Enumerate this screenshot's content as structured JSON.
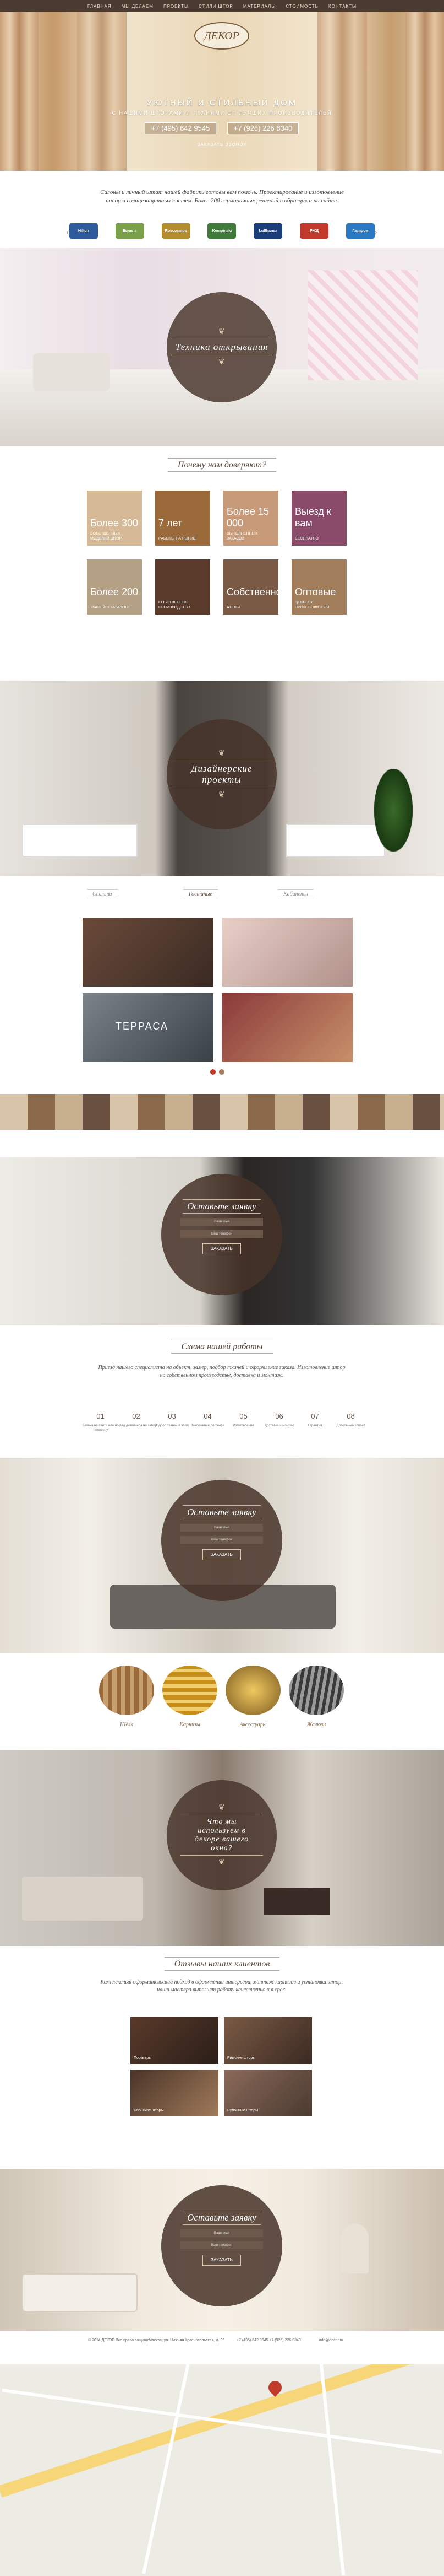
{
  "nav": [
    "ГЛАВНАЯ",
    "МЫ ДЕЛАЕМ",
    "ПРОЕКТЫ",
    "СТИЛИ ШТОР",
    "МАТЕРИАЛЫ",
    "СТОИМОСТЬ",
    "КОНТАКТЫ"
  ],
  "hero": {
    "logo": "ДЕКОР",
    "slogan": "УЮТНЫЙ И СТИЛЬНЫЙ ДОМ",
    "slogan2": "С НАШИМИ ШТОРАМИ И ТКАНЯМИ ОТ ЛУЧШИХ ПРОИЗВОДИТЕЛЕЙ",
    "phone1": "+7 (495) 642 9545",
    "phone2": "+7 (926) 226 8340",
    "link": "ЗАКАЗАТЬ ЗВОНОК"
  },
  "intro": {
    "text": "Салоны и личный штат нашей фабрики готовы вам помочь. Проектирование и изготовление штор и солнцезащитных систем. Более 200 гармоничных решений в образцах и на сайте.",
    "partners": [
      "Hilton",
      "Eurasia",
      "Roscosmos",
      "Kempinski",
      "Lufthansa",
      "РЖД",
      "Газпром"
    ]
  },
  "sec1": {
    "title": "Техника открывания"
  },
  "why": {
    "title": "Почему нам доверяют?",
    "tiles": [
      {
        "n": "Более 300",
        "d": "собственных моделей штор"
      },
      {
        "n": "7 лет",
        "d": "работы на рынке"
      },
      {
        "n": "Более 15 000",
        "d": "выполненных заказов"
      },
      {
        "n": "Выезд к вам",
        "d": "бесплатно"
      },
      {
        "n": "Более 200",
        "d": "тканей в каталоге"
      },
      {
        "n": "",
        "d": "собственное производство"
      },
      {
        "n": "Собственное",
        "d": "ателье"
      },
      {
        "n": "Оптовые",
        "d": "цены от производителя"
      }
    ]
  },
  "sec2": {
    "title": "Дизайнерские проекты"
  },
  "projects": {
    "tabs": [
      "Спальни",
      "Гостиные",
      "Кабинеты"
    ],
    "items": [
      {
        "label": ""
      },
      {
        "label": ""
      },
      {
        "label": "ТЕРРАСА"
      },
      {
        "label": ""
      }
    ]
  },
  "form1": {
    "title": "Оставьте заявку",
    "name": "Ваше имя",
    "phone": "Ваш телефон",
    "btn": "ЗАКАЗАТЬ"
  },
  "scheme": {
    "title": "Схема нашей работы",
    "text": "Приезд нашего специалиста на объект, замер, подбор тканей и оформление заказа. Изготовление штор на собственном производстве, доставка и монтаж.",
    "steps": [
      {
        "n": "01",
        "d": "Заявка на сайте или по телефону"
      },
      {
        "n": "02",
        "d": "Выезд дизайнера на замер"
      },
      {
        "n": "03",
        "d": "Подбор тканей и эскиз"
      },
      {
        "n": "04",
        "d": "Заключение договора"
      },
      {
        "n": "05",
        "d": "Изготовление"
      },
      {
        "n": "06",
        "d": "Доставка и монтаж"
      },
      {
        "n": "07",
        "d": "Гарантия"
      },
      {
        "n": "08",
        "d": "Довольный клиент"
      }
    ]
  },
  "form2": {
    "title": "Оставьте заявку",
    "name": "Ваше имя",
    "phone": "Ваш телефон",
    "btn": "ЗАКАЗАТЬ"
  },
  "materials": {
    "items": [
      "Шёлк",
      "Карнизы",
      "Аксессуары",
      "Жалюзи"
    ]
  },
  "sec3": {
    "title": "Что мы используем в декоре вашего окна?"
  },
  "portfolio": {
    "title": "Отзывы наших клиентов",
    "text": "Комплексный оформительский подход в оформлении интерьера, монтаж карнизов и установка штор: наши мастера выполнят работу качественно и в срок.",
    "items": [
      {
        "label": "Портьеры"
      },
      {
        "label": "Римские шторы"
      },
      {
        "label": "Японские шторы"
      },
      {
        "label": "Рулонные шторы"
      }
    ]
  },
  "form3": {
    "title": "Оставьте заявку",
    "name": "Ваше имя",
    "phone": "Ваш телефон",
    "btn": "ЗАКАЗАТЬ"
  },
  "footer": {
    "col1": "© 2014 ДЕКОР\nВсе права защищены",
    "col2": "Москва, ул. Нижняя Красносельская, д. 35",
    "col3": "+7 (495) 642 9545\n+7 (926) 226 8340",
    "col4": "info@decor.ru"
  },
  "colors": {
    "brown": "#46322a",
    "cream": "#e9d7b6",
    "accent": "#c0392b"
  }
}
